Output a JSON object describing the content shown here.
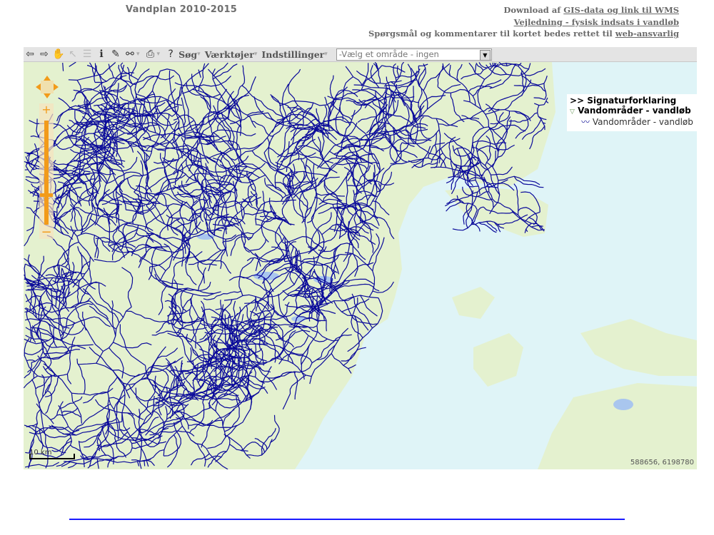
{
  "header": {
    "title": "Vandplan 2010-2015",
    "link_line1_prefix": "Download af ",
    "link_line1_link": "GIS-data og link til WMS",
    "link_line2": "Vejledning - fysisk indsats i vandløb",
    "link_line3_prefix": "Spørgsmål og kommentarer til kortet bedes rettet til ",
    "link_line3_link": "web-ansvarlig"
  },
  "toolbar": {
    "menu_search": "Søg",
    "menu_tools": "Værktøjer",
    "menu_settings": "Indstillinger",
    "area_select_value": "-Vælg et område - ingen"
  },
  "legend": {
    "heading": ">> Signaturforklaring",
    "layer_group": "Vandområder - vandløb",
    "layer_item": "Vandområder - vandløb"
  },
  "map": {
    "scale_label": "10 km",
    "coordinates": "588656, 6198780",
    "colors": {
      "land": "#e4f1cf",
      "sea": "#dff4f7",
      "river": "#0a0a9a",
      "lake": "#a9c6ee"
    }
  }
}
